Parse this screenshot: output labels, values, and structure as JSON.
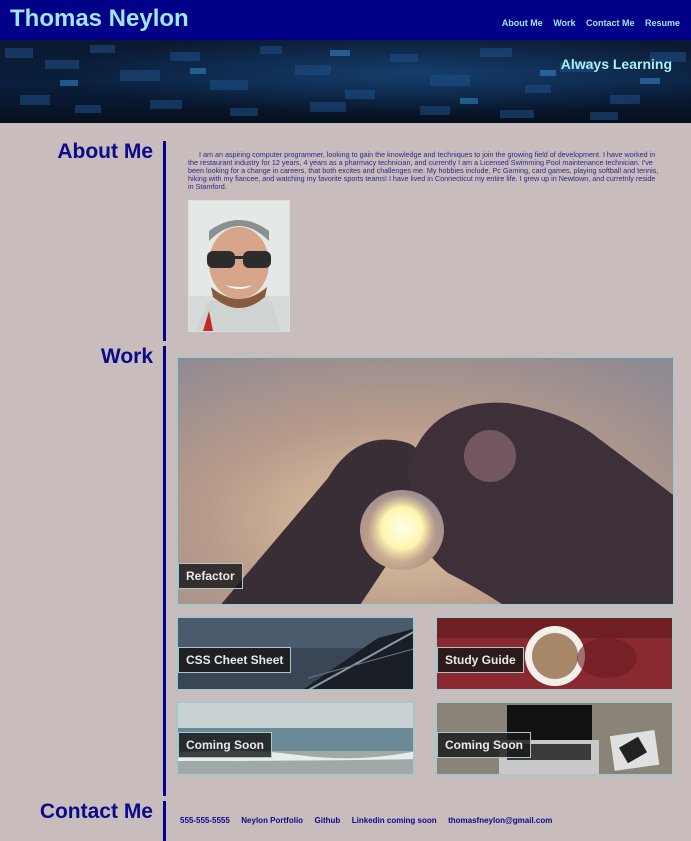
{
  "header": {
    "brand": "Thomas Neylon",
    "nav": [
      {
        "label": "About Me"
      },
      {
        "label": "Work"
      },
      {
        "label": "Contact Me"
      },
      {
        "label": "Resume"
      }
    ]
  },
  "banner": {
    "tagline": "Always Learning"
  },
  "about": {
    "heading": "About Me",
    "text": "I am an aspiring computer programmer, looking to gain the knowledge and techniques to join the growing field of development. I have worked in the restaurant industry for 12 years, 4 years as a pharmacy technician, and currently I am a Licensed Swimming Pool maintenance technician. I've been looking for a change in careers, that both excites and challenges me. My hobbies include, Pc Gaming, card games, playing softball and tennis, hiking with my fiancee, and watching my favorite sports teams! I have lived in Connecticut my entire life. I grew up in Newtown, and curretnly reside in Stamford."
  },
  "work": {
    "heading": "Work",
    "projects": [
      {
        "label": "Refactor"
      },
      {
        "label": "CSS Cheet Sheet"
      },
      {
        "label": "Study Guide"
      },
      {
        "label": "Coming Soon"
      },
      {
        "label": "Coming Soon"
      }
    ]
  },
  "contact": {
    "heading": "Contact Me",
    "links": [
      {
        "label": "555-555-5555"
      },
      {
        "label": "Neylon Portfolio"
      },
      {
        "label": "Github"
      },
      {
        "label": "Linkedin coming soon"
      },
      {
        "label": "thomasfneylon@gmail.com"
      }
    ]
  },
  "colors": {
    "header_bg": "#000088",
    "accent_text": "#9ee6f4",
    "page_bg": "#c9bcbd",
    "heading_text": "#0a0a8a"
  }
}
